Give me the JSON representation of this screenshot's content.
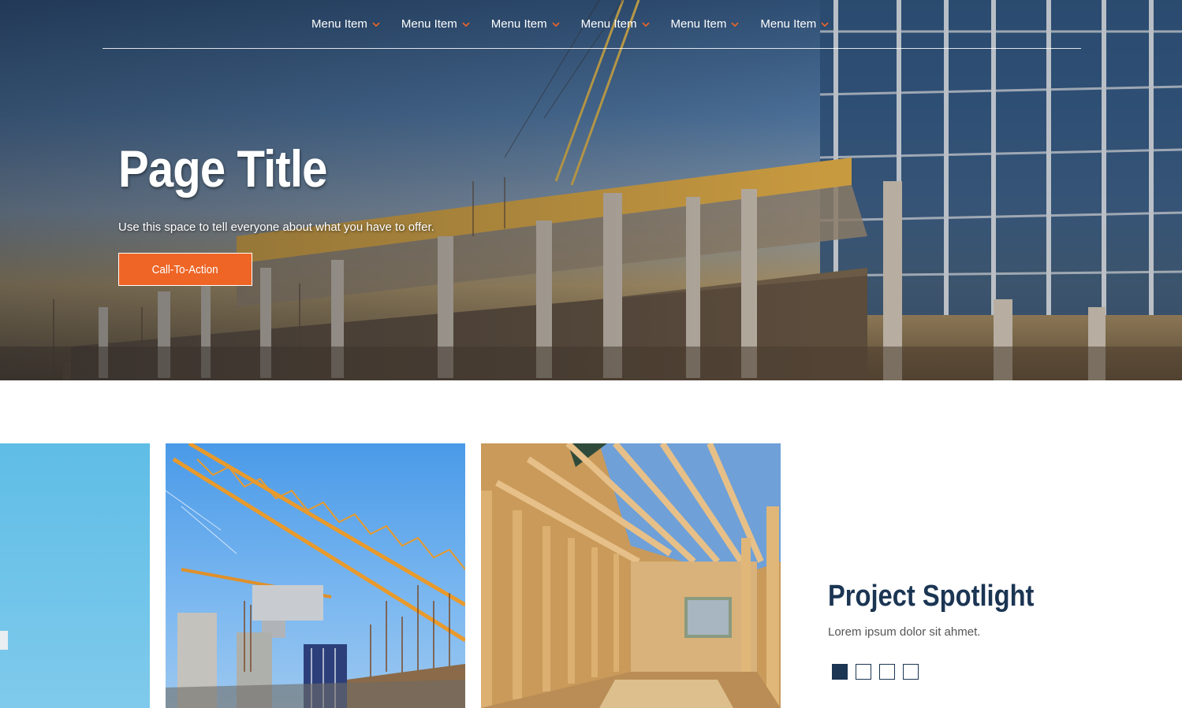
{
  "nav": {
    "items": [
      {
        "label": "Menu Item"
      },
      {
        "label": "Menu Item"
      },
      {
        "label": "Menu Item"
      },
      {
        "label": "Menu Item"
      },
      {
        "label": "Menu Item"
      },
      {
        "label": "Menu Item"
      }
    ],
    "caret_icon": "chevron-down-icon",
    "caret_color": "#ee6526"
  },
  "hero": {
    "title": "Page Title",
    "subtitle": "Use this space to tell everyone about what you have to offer.",
    "cta_label": "Call-To-Action",
    "cta_color": "#ee6526"
  },
  "spotlight": {
    "title": "Project Spotlight",
    "text": "Lorem ipsum dolor sit ahmet.",
    "pager_count": 4,
    "active_page": 1,
    "accent": "#1b3553"
  }
}
